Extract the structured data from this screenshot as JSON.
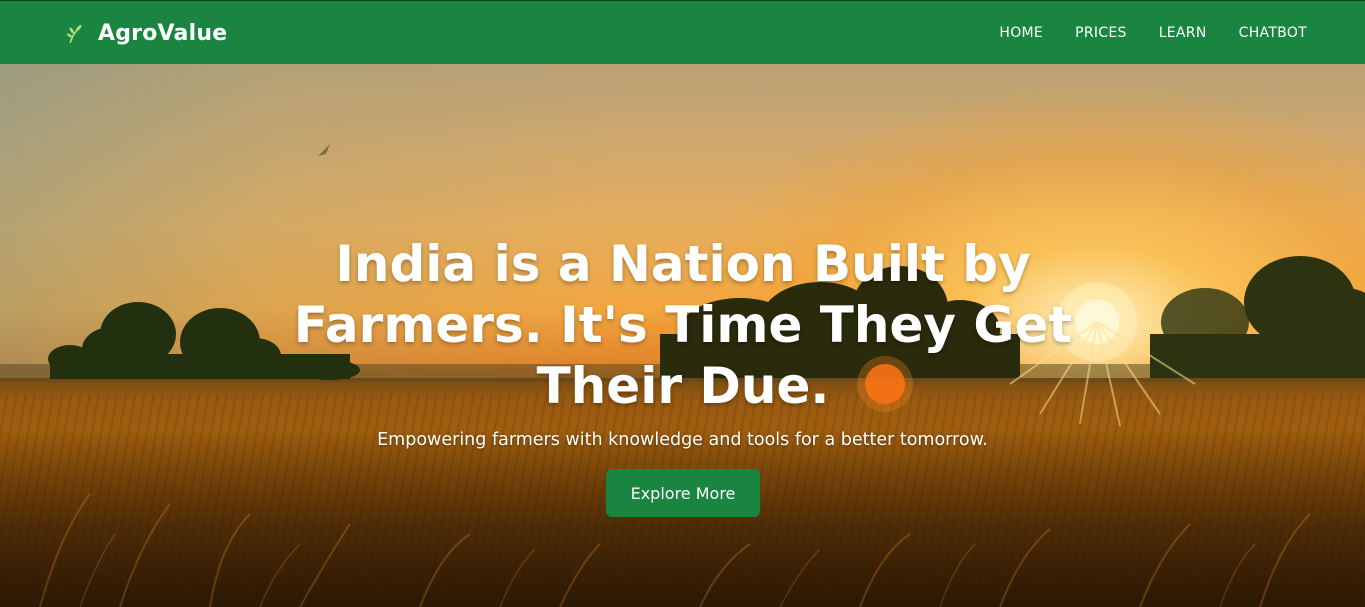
{
  "navbar": {
    "brand_icon": "leaf-sprout-icon",
    "brand_name": "AgroValue",
    "links": [
      {
        "label": "HOME"
      },
      {
        "label": "PRICES"
      },
      {
        "label": "LEARN"
      },
      {
        "label": "CHATBOT"
      }
    ]
  },
  "hero": {
    "background_image": "sunset-wheat-field-photo",
    "title": "India is a Nation Built by Farmers. It's Time They Get Their Due.",
    "subtitle": "Empowering farmers with knowledge and tools for a better tomorrow.",
    "cta_label": "Explore More"
  },
  "colors": {
    "brand_green": "#198540",
    "text_white": "#ffffff"
  }
}
